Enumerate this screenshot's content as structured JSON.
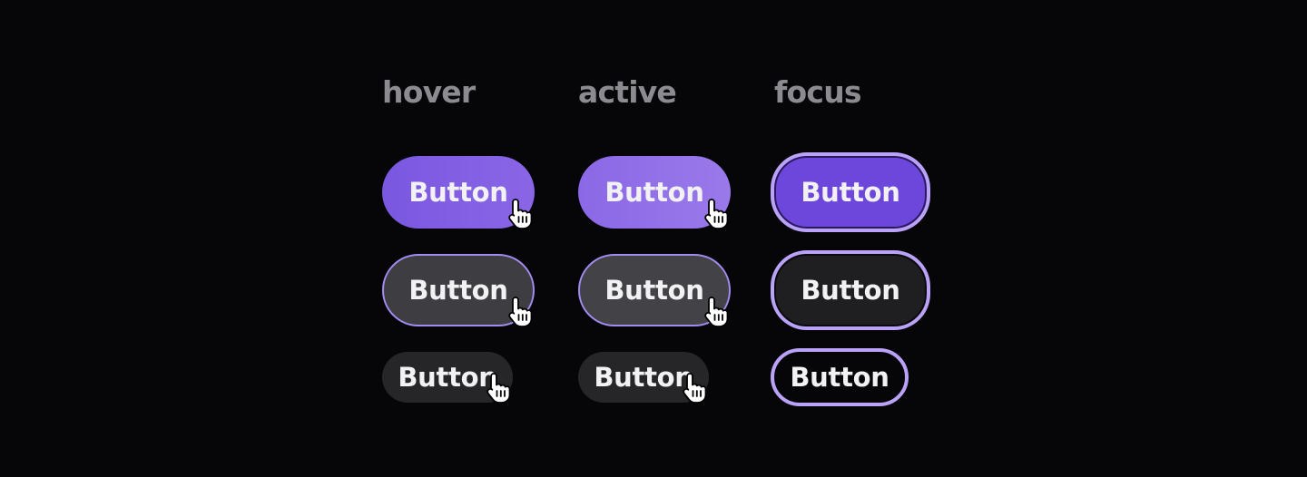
{
  "columns": {
    "hover": {
      "title": "hover",
      "buttons": [
        "Button",
        "Button",
        "Button"
      ]
    },
    "active": {
      "title": "active",
      "buttons": [
        "Button",
        "Button",
        "Button"
      ]
    },
    "focus": {
      "title": "focus",
      "buttons": [
        "Button",
        "Button",
        "Button"
      ]
    }
  },
  "colors": {
    "background": "#060609",
    "primary": "#7a57e0",
    "primary_active": "#8b68e6",
    "primary_focus": "#6d46dc",
    "focus_ring": "#b9a2f7",
    "secondary": "#3e3e42",
    "tertiary": "#262628",
    "heading": "#8b8b90"
  },
  "icons": {
    "cursor": "hand-pointer-icon"
  }
}
